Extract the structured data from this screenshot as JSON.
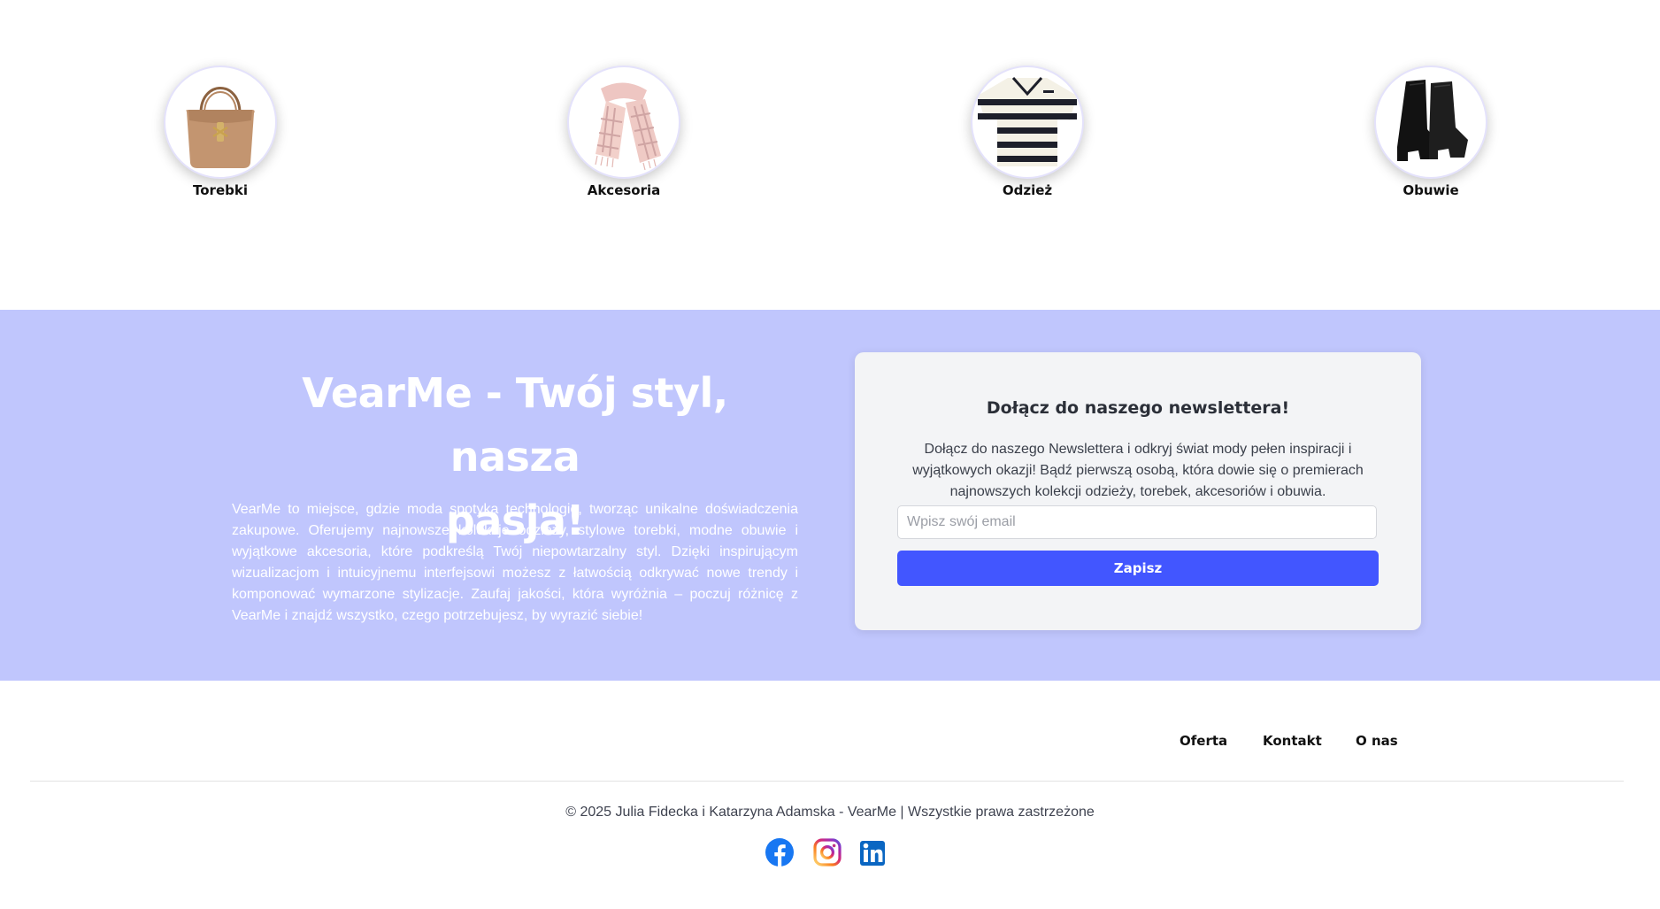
{
  "categories": [
    {
      "label": "Torebki",
      "icon": "handbag-image"
    },
    {
      "label": "Akcesoria",
      "icon": "scarf-image"
    },
    {
      "label": "Odzież",
      "icon": "striped-polo-image"
    },
    {
      "label": "Obuwie",
      "icon": "boots-image"
    }
  ],
  "hero": {
    "title_line1": "VearMe - Twój styl, nasza",
    "title_line2": "pasja!",
    "text": "VearMe to miejsce, gdzie moda spotyka technologię, tworząc unikalne doświadczenia zakupowe. Oferujemy najnowsze kolekcje odzieży, stylowe torebki, modne obuwie i wyjątkowe akcesoria, które podkreślą Twój niepowtarzalny styl. Dzięki inspirującym wizualizacjom i intuicyjnemu interfejsowi możesz z łatwością odkrywać nowe trendy i komponować wymarzone stylizacje. Zaufaj jakości, która wyróżnia – poczuj różnicę z VearMe i znajdź wszystko, czego potrzebujesz, by wyrazić siebie!",
    "background": "#c0c6fd"
  },
  "newsletter": {
    "title": "Dołącz do naszego newslettera!",
    "description": "Dołącz do naszego Newslettera i odkryj świat mody pełen inspiracji i wyjątkowych okazji! Bądź pierwszą osobą, która dowie się o premierach najnowszych kolekcji odzieży, torebek, akcesoriów i obuwia.",
    "email_placeholder": "Wpisz swój email",
    "email_value": "",
    "button_label": "Zapisz",
    "button_color": "#4256ff"
  },
  "footer": {
    "nav": [
      "Oferta",
      "Kontakt",
      "O nas"
    ],
    "copyright": "© 2025 Julia Fidecka i Katarzyna Adamska - VearMe | Wszystkie prawa zastrzeżone",
    "socials": [
      {
        "name": "facebook-icon",
        "color": "#1877f2"
      },
      {
        "name": "instagram-icon",
        "color": "#e1306c"
      },
      {
        "name": "linkedin-icon",
        "color": "#0a66c2"
      }
    ]
  }
}
